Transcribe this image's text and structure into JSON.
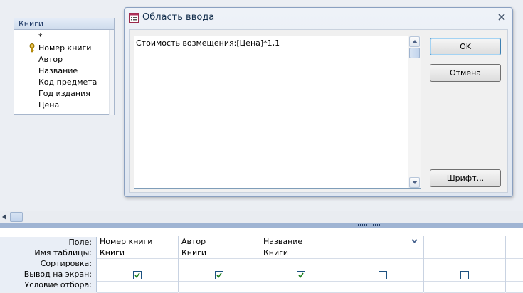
{
  "field_list": {
    "title": "Книги",
    "items": [
      "*",
      "Номер книги",
      "Автор",
      "Название",
      "Код предмета",
      "Год издания",
      "Цена"
    ],
    "key_index": 1
  },
  "dialog": {
    "title": "Область ввода",
    "expression": "Стоимость возмещения:[Цена]*1,1",
    "ok_label": "OK",
    "cancel_label": "Отмена",
    "font_label": "Шрифт..."
  },
  "grid": {
    "row_labels": [
      "Поле:",
      "Имя таблицы:",
      "Сортировка:",
      "Вывод на экран:",
      "Условие отбора:"
    ],
    "columns": [
      {
        "field": "Номер книги",
        "table": "Книги",
        "show": true
      },
      {
        "field": "Автор",
        "table": "Книги",
        "show": true
      },
      {
        "field": "Название",
        "table": "Книги",
        "show": true
      },
      {
        "field": "",
        "table": "",
        "show": false
      },
      {
        "field": "",
        "table": "",
        "show": false
      },
      {
        "field": "",
        "table": "",
        "show": false
      }
    ]
  },
  "colors": {
    "accent": "#1c5180",
    "checkmark": "#1a7d1a",
    "splitter": "#9fb4d3"
  }
}
